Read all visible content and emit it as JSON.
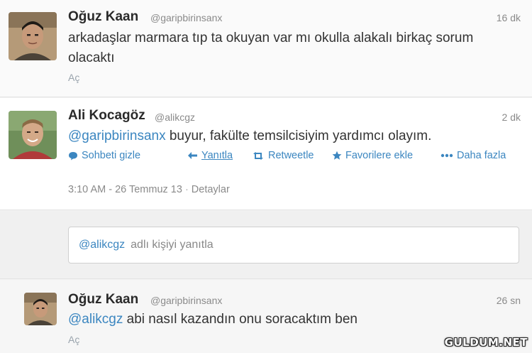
{
  "tweets": [
    {
      "author": "Oğuz Kaan",
      "handle": "@garipbirinsanx",
      "time": "16 dk",
      "text": "arkadaşlar marmara tıp ta okuyan var mı okulla alakalı birkaç sorum olacaktı",
      "expand": "Aç"
    },
    {
      "author": "Ali Kocagöz",
      "handle": "@alikcgz",
      "time": "2 dk",
      "mention": "@garipbirinsanx",
      "text": " buyur, fakülte temsilcisiyim yardımcı olayım.",
      "actions": {
        "hide": "Sohbeti gizle",
        "reply": "Yanıtla",
        "retweet": "Retweetle",
        "favorite": "Favorilere ekle",
        "more": "Daha fazla"
      },
      "timestamp": "3:10 AM - 26 Temmuz 13",
      "details": "Detaylar"
    },
    {
      "author": "Oğuz Kaan",
      "handle": "@garipbirinsanx",
      "time": "26 sn",
      "mention": "@alikcgz",
      "text": " abi nasıl kazandın onu soracaktım ben",
      "expand": "Aç"
    }
  ],
  "reply_box": {
    "mention": "@alikcgz",
    "placeholder": "adlı kişiyi yanıtla"
  },
  "watermark": "GULDUM.NET",
  "colors": {
    "link": "#3b86c0",
    "muted": "#8a8a8a"
  }
}
